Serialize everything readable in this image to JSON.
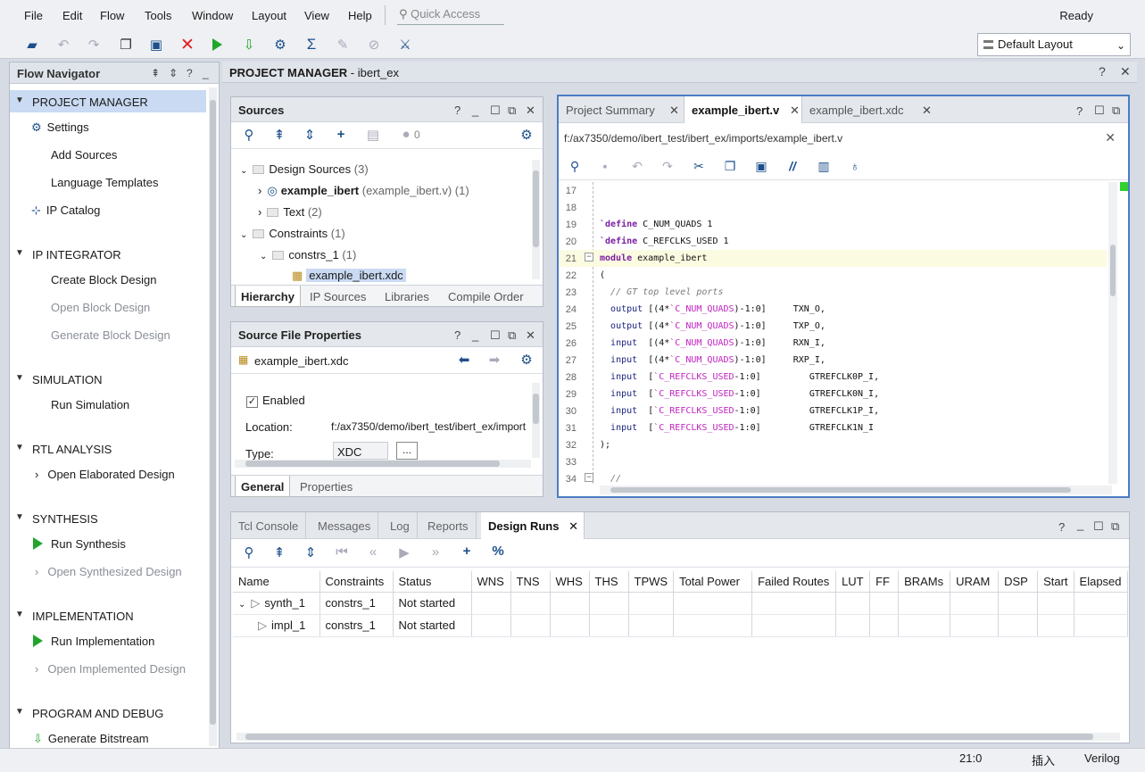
{
  "menu": [
    "File",
    "Edit",
    "Flow",
    "Tools",
    "Window",
    "Layout",
    "View",
    "Help"
  ],
  "quick_access": "Quick Access",
  "status_ready": "Ready",
  "layout_select": "Default Layout",
  "flow_navigator": {
    "title": "Flow Navigator",
    "sections": [
      {
        "label": "PROJECT MANAGER",
        "items": [
          "Settings",
          "Add Sources",
          "Language Templates",
          "IP Catalog"
        ]
      },
      {
        "label": "IP INTEGRATOR",
        "items": [
          "Create Block Design",
          "Open Block Design",
          "Generate Block Design"
        ]
      },
      {
        "label": "SIMULATION",
        "items": [
          "Run Simulation"
        ]
      },
      {
        "label": "RTL ANALYSIS",
        "items": [
          "Open Elaborated Design"
        ]
      },
      {
        "label": "SYNTHESIS",
        "items": [
          "Run Synthesis",
          "Open Synthesized Design"
        ]
      },
      {
        "label": "IMPLEMENTATION",
        "items": [
          "Run Implementation",
          "Open Implemented Design"
        ]
      },
      {
        "label": "PROGRAM AND DEBUG",
        "items": [
          "Generate Bitstream"
        ]
      }
    ]
  },
  "project_header": {
    "prefix": "PROJECT MANAGER",
    "project": " - ibert_ex"
  },
  "sources": {
    "title": "Sources",
    "badge_count": "0",
    "tree": {
      "design_sources": "Design Sources",
      "design_sources_count": "(3)",
      "example_ibert": "example_ibert",
      "example_ibert_file": "(example_ibert.v) (1)",
      "text": "Text",
      "text_count": "(2)",
      "constraints": "Constraints",
      "constraints_count": "(1)",
      "constrs_1": "constrs_1",
      "constrs_1_count": "(1)",
      "xdc_file": "example_ibert.xdc"
    },
    "tabs": [
      "Hierarchy",
      "IP Sources",
      "Libraries",
      "Compile Order"
    ]
  },
  "properties": {
    "title": "Source File Properties",
    "file": "example_ibert.xdc",
    "enabled_label": "Enabled",
    "location_label": "Location:",
    "location_value": "f:/ax7350/demo/ibert_test/ibert_ex/import",
    "type_label": "Type:",
    "type_value": "XDC",
    "more": "...",
    "tabs": [
      "General",
      "Properties"
    ]
  },
  "editor": {
    "tabs": [
      "Project Summary",
      "example_ibert.v",
      "example_ibert.xdc"
    ],
    "path": "f:/ax7350/demo/ibert_test/ibert_ex/imports/example_ibert.v",
    "lines": [
      {
        "n": "17",
        "t": ""
      },
      {
        "n": "18",
        "t": ""
      },
      {
        "n": "19",
        "t": "`define C_NUM_QUADS 1"
      },
      {
        "n": "20",
        "t": "`define C_REFCLKS_USED 1"
      },
      {
        "n": "21",
        "t": "module example_ibert"
      },
      {
        "n": "22",
        "t": "("
      },
      {
        "n": "23",
        "t": "  // GT top level ports"
      },
      {
        "n": "24",
        "t": "  output [(4*`C_NUM_QUADS)-1:0]     TXN_O,"
      },
      {
        "n": "25",
        "t": "  output [(4*`C_NUM_QUADS)-1:0]     TXP_O,"
      },
      {
        "n": "26",
        "t": "  input  [(4*`C_NUM_QUADS)-1:0]     RXN_I,"
      },
      {
        "n": "27",
        "t": "  input  [(4*`C_NUM_QUADS)-1:0]     RXP_I,"
      },
      {
        "n": "28",
        "t": "  input  [`C_REFCLKS_USED-1:0]         GTREFCLK0P_I,"
      },
      {
        "n": "29",
        "t": "  input  [`C_REFCLKS_USED-1:0]         GTREFCLK0N_I,"
      },
      {
        "n": "30",
        "t": "  input  [`C_REFCLKS_USED-1:0]         GTREFCLK1P_I,"
      },
      {
        "n": "31",
        "t": "  input  [`C_REFCLKS_USED-1:0]         GTREFCLK1N_I"
      },
      {
        "n": "32",
        "t": ");"
      },
      {
        "n": "33",
        "t": ""
      },
      {
        "n": "34",
        "t": "  //"
      }
    ]
  },
  "bottom": {
    "tabs": [
      "Tcl Console",
      "Messages",
      "Log",
      "Reports",
      "Design Runs"
    ],
    "columns": [
      "Name",
      "Constraints",
      "Status",
      "WNS",
      "TNS",
      "WHS",
      "THS",
      "TPWS",
      "Total Power",
      "Failed Routes",
      "LUT",
      "FF",
      "BRAMs",
      "URAM",
      "DSP",
      "Start",
      "Elapsed"
    ],
    "rows": [
      {
        "name": "synth_1",
        "constraints": "constrs_1",
        "status": "Not started"
      },
      {
        "name": "impl_1",
        "constraints": "constrs_1",
        "status": "Not started"
      }
    ]
  },
  "statusbar": {
    "position": "21:0",
    "mode": "插入",
    "language": "Verilog"
  },
  "colors": {
    "accent": "#4b7cc4",
    "run_green": "#21a52d",
    "stop_red": "#e02020",
    "selection": "#c9daf2"
  }
}
